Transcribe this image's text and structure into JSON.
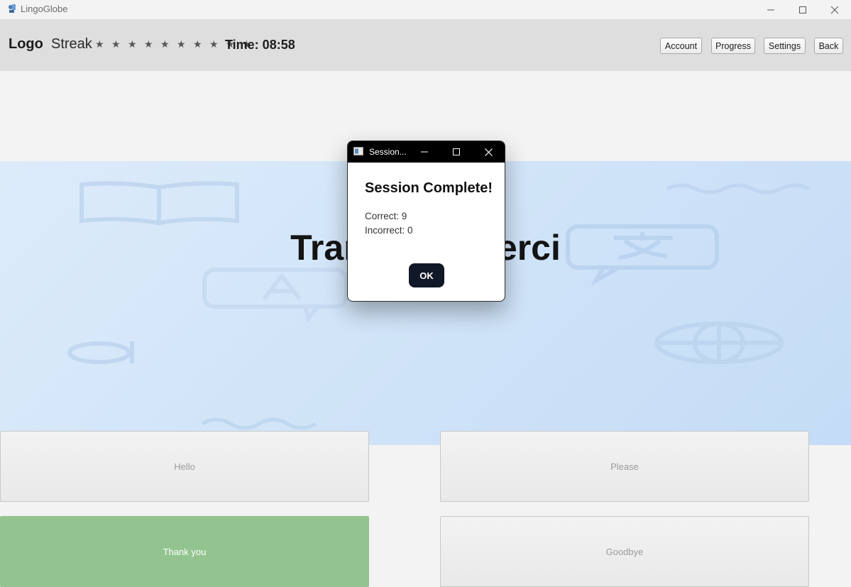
{
  "window": {
    "title": "LingoGlobe",
    "controls": [
      "minimize-icon",
      "maximize-icon",
      "close-icon"
    ]
  },
  "header": {
    "logo": "Logo",
    "streak_label": "Streak",
    "streak_stars": "★ ★ ★ ★ ★ ★ ★ ★ ★ ★",
    "timer": "Time: 08:58",
    "buttons": {
      "account": "Account",
      "progress": "Progress",
      "settings": "Settings",
      "back": "Back"
    }
  },
  "prompt": {
    "text": "Translate: Merci"
  },
  "answers": [
    {
      "label": "Hello",
      "state": "normal"
    },
    {
      "label": "Please",
      "state": "normal"
    },
    {
      "label": "Thank you",
      "state": "correct"
    },
    {
      "label": "Goodbye",
      "state": "normal"
    }
  ],
  "dialog": {
    "window_title": "Session...",
    "heading": "Session Complete!",
    "correct_label": "Correct: ",
    "correct_value": "9",
    "incorrect_label": "Incorrect: ",
    "incorrect_value": "0",
    "ok_label": "OK"
  },
  "colors": {
    "header_bg": "#dedede",
    "banner_bg": "#d6e7f9",
    "correct_answer": "#93c48f",
    "dialog_titlebar": "#000000",
    "ok_button": "#111827"
  },
  "decorative_icons": [
    "book-icon",
    "translate-bubble-icon",
    "letter-a-bubble-icon",
    "globe-icon",
    "wave-icon",
    "letter-a-icon"
  ]
}
